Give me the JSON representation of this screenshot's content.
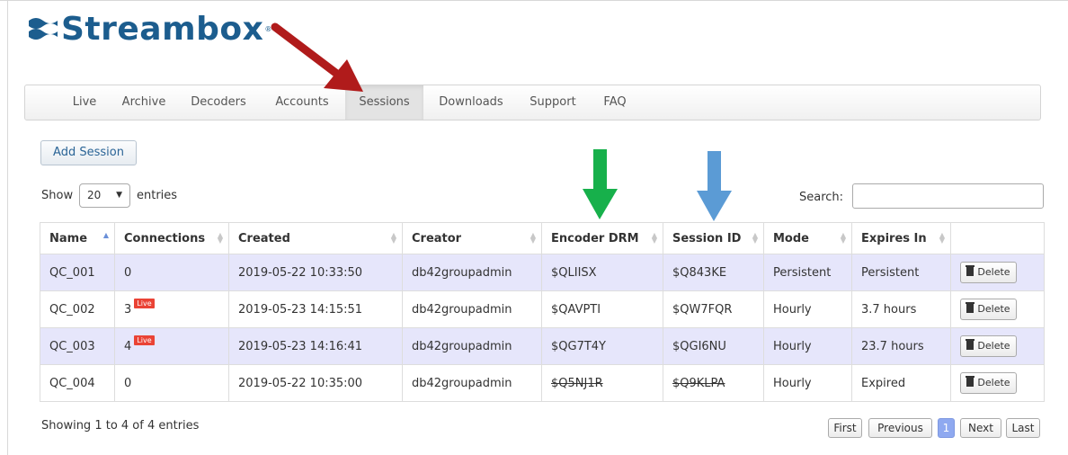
{
  "brand": {
    "name": "Streambox",
    "reg_mark": "®"
  },
  "nav": {
    "items": [
      {
        "label": "Live"
      },
      {
        "label": "Archive"
      },
      {
        "label": "Decoders"
      },
      {
        "label": "Accounts"
      },
      {
        "label": "Sessions",
        "active": true
      },
      {
        "label": "Downloads"
      },
      {
        "label": "Support"
      },
      {
        "label": "FAQ"
      }
    ]
  },
  "toolbar": {
    "add_session_label": "Add Session"
  },
  "length": {
    "show_label": "Show",
    "value": "20",
    "entries_label": "entries"
  },
  "search": {
    "label": "Search:",
    "value": ""
  },
  "table": {
    "headers": [
      "Name",
      "Connections",
      "Created",
      "Creator",
      "Encoder DRM",
      "Session ID",
      "Mode",
      "Expires In"
    ],
    "live_badge": "Live",
    "delete_label": "Delete",
    "rows": [
      {
        "name": "QC_001",
        "connections": "0",
        "live": false,
        "created": "2019-05-22 10:33:50",
        "creator": "db42groupadmin",
        "drm": "$QLIISX",
        "session_id": "$Q843KE",
        "mode": "Persistent",
        "expires": "Persistent",
        "expired": false
      },
      {
        "name": "QC_002",
        "connections": "3",
        "live": true,
        "created": "2019-05-23 14:15:51",
        "creator": "db42groupadmin",
        "drm": "$QAVPTI",
        "session_id": "$QW7FQR",
        "mode": "Hourly",
        "expires": "3.7 hours",
        "expired": false
      },
      {
        "name": "QC_003",
        "connections": "4",
        "live": true,
        "created": "2019-05-23 14:16:41",
        "creator": "db42groupadmin",
        "drm": "$QG7T4Y",
        "session_id": "$QGI6NU",
        "mode": "Hourly",
        "expires": "23.7 hours",
        "expired": false
      },
      {
        "name": "QC_004",
        "connections": "0",
        "live": false,
        "created": "2019-05-22 10:35:00",
        "creator": "db42groupadmin",
        "drm": "$Q5NJ1R",
        "session_id": "$Q9KLPA",
        "mode": "Hourly",
        "expires": "Expired",
        "expired": true
      }
    ]
  },
  "footer": {
    "info": "Showing 1 to 4 of 4 entries"
  },
  "pagination": {
    "first": "First",
    "previous": "Previous",
    "current": "1",
    "next": "Next",
    "last": "Last"
  },
  "colors": {
    "brand": "#1c5d8e",
    "annotation_red": "#b01b1b",
    "annotation_green": "#17b04b",
    "annotation_blue": "#5b9bd5",
    "alt_row": "#e6e6fb",
    "expired": "#e04848"
  },
  "icons": [
    "streambox-logo-icon",
    "caret-down-icon",
    "trash-icon",
    "sort-icon",
    "red-arrow-icon",
    "green-arrow-icon",
    "blue-arrow-icon"
  ]
}
